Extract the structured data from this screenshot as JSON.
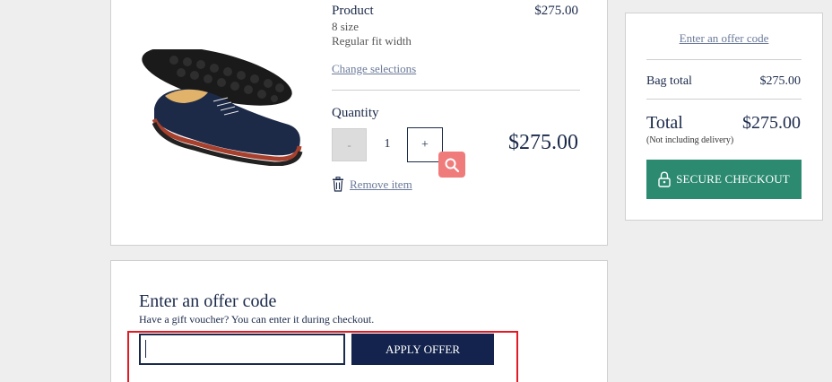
{
  "product": {
    "name": "Product",
    "price": "$275.00",
    "size": "8 size",
    "fit": "Regular fit width",
    "change_link": "Change selections",
    "quantity_label": "Quantity",
    "minus_label": "-",
    "quantity_value": "1",
    "plus_label": "+",
    "line_total": "$275.00",
    "remove_link": "Remove item",
    "image_icon": "shoe-image"
  },
  "summary": {
    "offer_link": "Enter an offer code",
    "bag_total_label": "Bag total",
    "bag_total_value": "$275.00",
    "total_label": "Total",
    "total_value": "$275.00",
    "total_note": "(Not including delivery)",
    "checkout_label": "SECURE CHECKOUT",
    "checkout_icon": "lock-icon"
  },
  "offer": {
    "title": "Enter an offer code",
    "subtitle": "Have a gift voucher? You can enter it during checkout.",
    "input_value": "",
    "apply_label": "APPLY OFFER"
  },
  "colors": {
    "navy": "#13234d",
    "green": "#2b8a70",
    "highlight": "#e01b24",
    "zoom_badge": "#f07b7b"
  }
}
